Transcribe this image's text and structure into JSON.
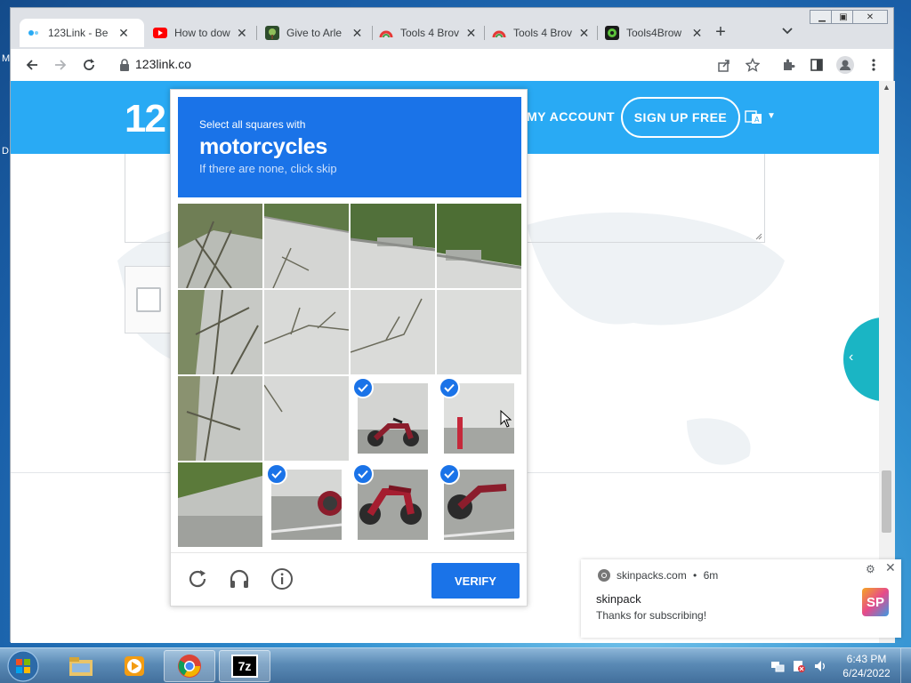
{
  "desktop": {
    "left_fragment_1": "M",
    "left_fragment_2": "D"
  },
  "browser": {
    "tabs": [
      {
        "title": "123Link - Be",
        "favicon": "123link-icon",
        "active": true
      },
      {
        "title": "How to dow",
        "favicon": "youtube-icon",
        "active": false
      },
      {
        "title": "Give to Arle",
        "favicon": "give-icon",
        "active": false
      },
      {
        "title": "Tools 4 Brov",
        "favicon": "tools4-icon",
        "active": false
      },
      {
        "title": "Tools 4 Brov",
        "favicon": "tools4-icon",
        "active": false
      },
      {
        "title": "Tools4Brow",
        "favicon": "tools4brow-icon",
        "active": false
      }
    ],
    "new_tab": "+",
    "url": "123link.co"
  },
  "site": {
    "logo_text": "12",
    "nav_account": "MY ACCOUNT",
    "nav_signup": "SIGN UP FREE"
  },
  "captcha": {
    "prompt_line": "Select all squares with",
    "prompt_object": "motorcycles",
    "prompt_hint": "If there are none, click skip",
    "verify_label": "VERIFY",
    "selected_tiles": [
      10,
      11,
      13,
      14,
      15
    ]
  },
  "notification": {
    "site": "skinpacks.com",
    "age": "6m",
    "separator": "•",
    "title": "skinpack",
    "body": "Thanks for subscribing!",
    "logo_text": "SP"
  },
  "taskbar": {
    "time": "6:43 PM",
    "date": "6/24/2022",
    "apps": [
      "explorer",
      "media-player",
      "chrome",
      "7zip"
    ],
    "seven_zip_label": "7z"
  },
  "colors": {
    "site_header": "#29aaf4",
    "captcha_blue": "#1a73e8",
    "carousel": "#1ab5c4"
  }
}
